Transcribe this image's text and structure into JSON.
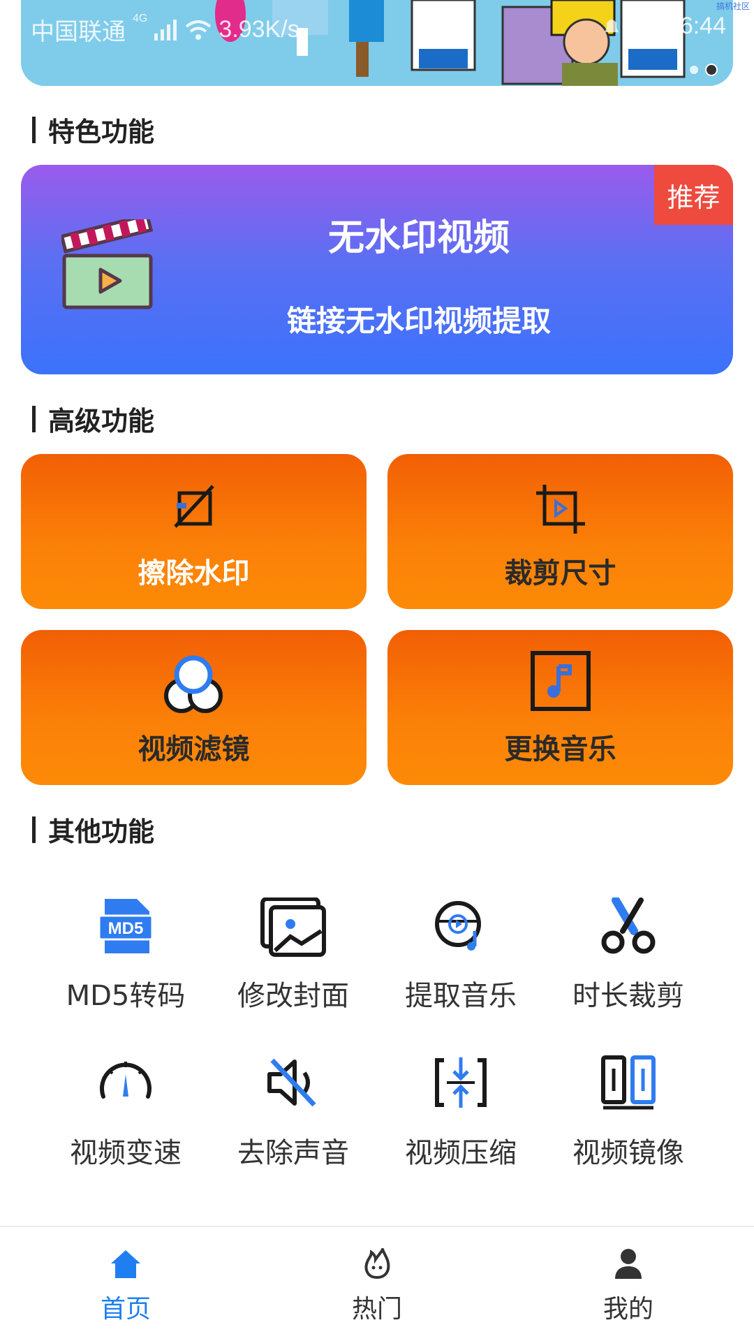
{
  "status_bar": {
    "carrier": "中国联通",
    "network": "4G",
    "speed": "3.93K/s",
    "time": "16:44",
    "watermark": "搞机社区"
  },
  "banner": {
    "active_dot": 2,
    "dot_count": 2
  },
  "featured": {
    "section_title": "特色功能",
    "card": {
      "title": "无水印视频",
      "subtitle": "链接无水印视频提取",
      "badge": "推荐",
      "icon": "clapperboard-icon"
    }
  },
  "advanced": {
    "section_title": "高级功能",
    "cards": [
      {
        "label": "擦除水印",
        "icon": "erase-watermark-icon",
        "label_color": "#ffffff"
      },
      {
        "label": "裁剪尺寸",
        "icon": "crop-icon",
        "label_color": "#2a2a2a"
      },
      {
        "label": "视频滤镜",
        "icon": "filter-icon",
        "label_color": "#2a2a2a"
      },
      {
        "label": "更换音乐",
        "icon": "music-icon",
        "label_color": "#2a2a2a"
      }
    ]
  },
  "others": {
    "section_title": "其他功能",
    "tools": [
      {
        "label": "MD5转码",
        "icon": "md5-file-icon"
      },
      {
        "label": "修改封面",
        "icon": "image-cover-icon"
      },
      {
        "label": "提取音乐",
        "icon": "extract-music-icon"
      },
      {
        "label": "时长裁剪",
        "icon": "scissors-icon"
      },
      {
        "label": "视频变速",
        "icon": "speedometer-icon"
      },
      {
        "label": "去除声音",
        "icon": "mute-icon"
      },
      {
        "label": "视频压缩",
        "icon": "compress-icon"
      },
      {
        "label": "视频镜像",
        "icon": "mirror-icon"
      }
    ]
  },
  "tab_bar": {
    "tabs": [
      {
        "label": "首页",
        "icon": "home-icon",
        "active": true
      },
      {
        "label": "热门",
        "icon": "fire-icon",
        "active": false
      },
      {
        "label": "我的",
        "icon": "user-icon",
        "active": false
      }
    ],
    "active_color": "#1f7ff0",
    "inactive_color": "#333333"
  },
  "colors": {
    "accent_blue": "#1f7ff0",
    "badge_red": "#ee4a3e",
    "card_orange": "#fb8108"
  }
}
